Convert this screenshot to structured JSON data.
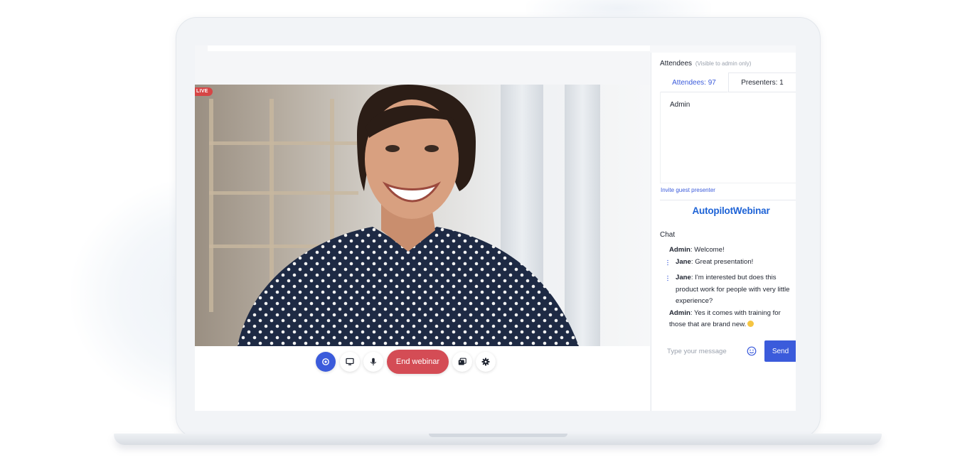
{
  "stage": {
    "live_badge": "LIVE"
  },
  "controls": {
    "end_webinar_label": "End webinar"
  },
  "panel": {
    "attendees_heading": "Attendees",
    "attendees_note": "(Visible to admin only)",
    "tabs": [
      {
        "label": "Attendees: 97",
        "active": true
      },
      {
        "label": "Presenters: 1",
        "active": false
      }
    ],
    "attendee_list": [
      "Admin"
    ],
    "invite_link": "Invite guest presenter",
    "logo_text": "AutopilotWebinar",
    "chat_heading": "Chat"
  },
  "chat": {
    "messages": [
      {
        "author": "Admin",
        "text": "Welcome!"
      },
      {
        "author": "Jane",
        "text": "Great presentation!"
      },
      {
        "author": "Jane",
        "text": "I'm interested but does this product work for people with very little experience?"
      },
      {
        "author": "Admin",
        "text": "Yes it comes with training for those that are brand new."
      }
    ],
    "input_placeholder": "Type your message",
    "send_label": "Send"
  },
  "colors": {
    "accent": "#3b5bdb",
    "end_button": "#d44c55",
    "logo": "#1e63d6",
    "live": "#d64545"
  }
}
